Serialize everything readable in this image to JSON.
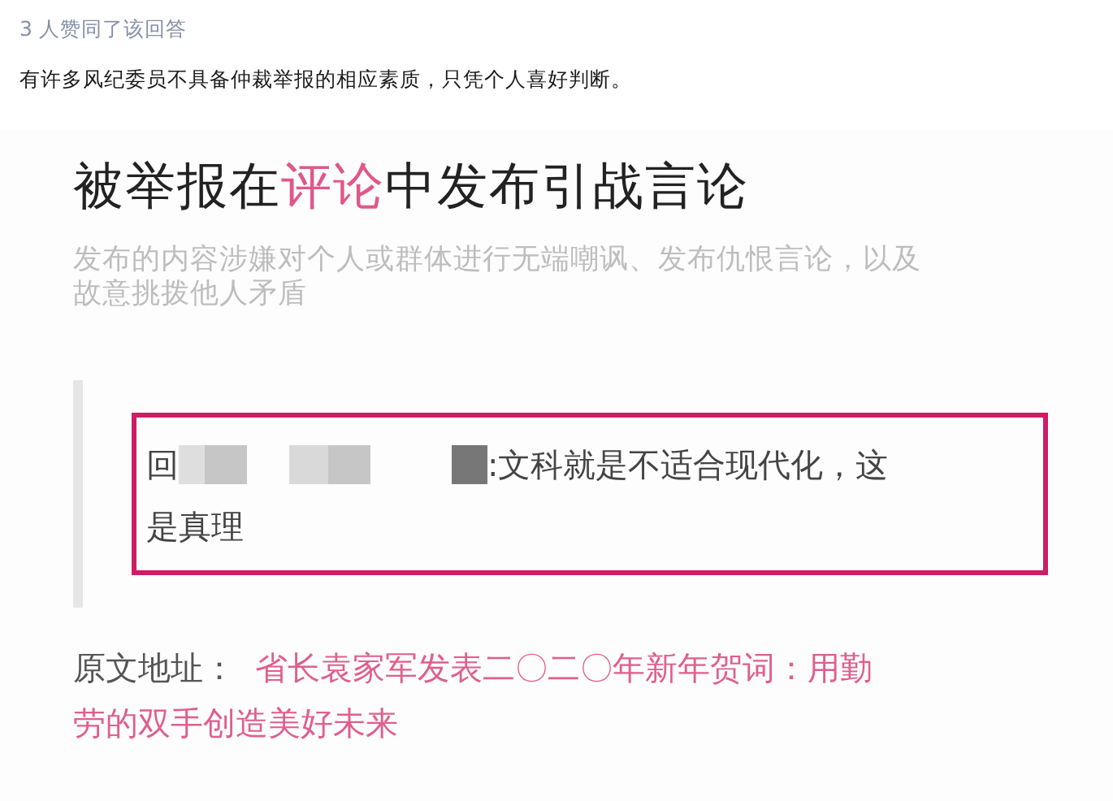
{
  "vote_count": "3 人赞同了该回答",
  "answer_text": "有许多风纪委员不具备仲裁举报的相应素质，只凭个人喜好判断。",
  "screenshot": {
    "title_parts": [
      {
        "text": "被举报在",
        "highlight": false
      },
      {
        "text": "评论",
        "highlight": true
      },
      {
        "text": "中发布引战言论",
        "highlight": false
      }
    ],
    "description": "发布的内容涉嫌对个人或群体进行无端嘲讽、发布仇恨言论，以及故意挑拨他人矛盾",
    "reply_prefix": "回",
    "reply_lines": [
      ":文科就是不适合现代化，这",
      "是真理"
    ],
    "source_label": "原文地址：",
    "source_link": "省长袁家军发表二〇二〇年新年贺词：用勤劳的双手创造美好未来"
  }
}
